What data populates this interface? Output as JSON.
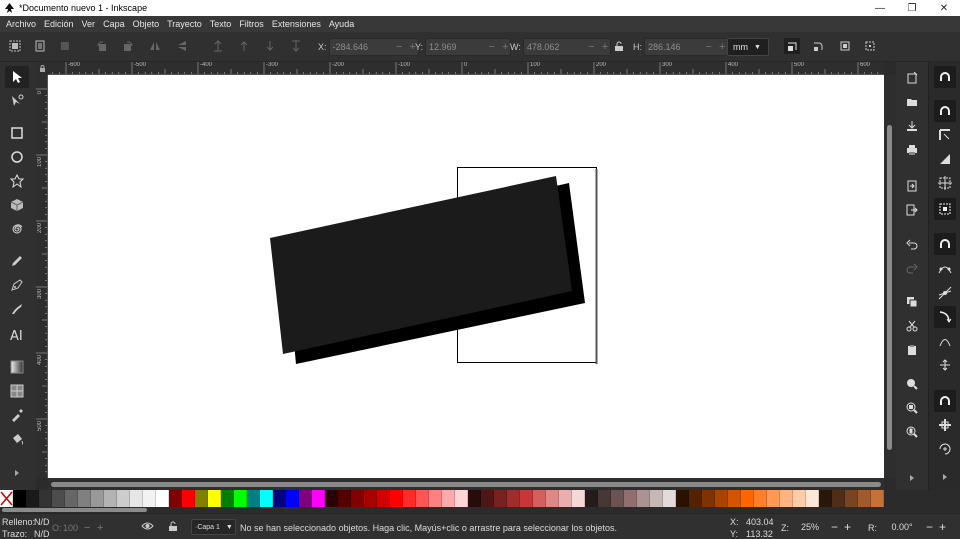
{
  "window": {
    "title": "*Documento nuevo 1 - Inkscape",
    "controls": [
      "—",
      "❐",
      "✕"
    ]
  },
  "menu": [
    "Archivo",
    "Edición",
    "Ver",
    "Capa",
    "Objeto",
    "Trayecto",
    "Texto",
    "Filtros",
    "Extensiones",
    "Ayuda"
  ],
  "toolcontrols": {
    "x_label": "X:",
    "x_value": "-284.646",
    "y_label": "Y:",
    "y_value": "12.969",
    "w_label": "W:",
    "w_value": "478.062",
    "h_label": "H:",
    "h_value": "286.146",
    "unit": "mm",
    "minus": "−",
    "plus": "+"
  },
  "rulers": {
    "horizontal": [
      "-600",
      "-500",
      "-400",
      "-300",
      "-200",
      "-100",
      "0",
      "100",
      "200",
      "300",
      "400",
      "500",
      "600"
    ],
    "vertical": [
      "0",
      "100",
      "200",
      "300",
      "400",
      "500",
      "600",
      "700"
    ]
  },
  "palette": {
    "colors": [
      "#000000",
      "#1a1a1a",
      "#333333",
      "#4d4d4d",
      "#666666",
      "#808080",
      "#999999",
      "#b3b3b3",
      "#cccccc",
      "#e6e6e6",
      "#f2f2f2",
      "#ffffff",
      "#800000",
      "#ff0000",
      "#808000",
      "#ffff00",
      "#008000",
      "#00ff00",
      "#008080",
      "#00ffff",
      "#000080",
      "#0000ff",
      "#800080",
      "#ff00ff",
      "#2b0000",
      "#550000",
      "#800000",
      "#aa0000",
      "#d40000",
      "#ff0000",
      "#ff2a2a",
      "#ff5555",
      "#ff8080",
      "#ffaaaa",
      "#ffd5d5",
      "#280b0b",
      "#501616",
      "#782121",
      "#a02c2c",
      "#c83737",
      "#d35f5f",
      "#de8787",
      "#e9afaf",
      "#f4d7d7",
      "#241c1c",
      "#483737",
      "#6c5353",
      "#916f6f",
      "#ac9393",
      "#c8b7b7",
      "#e3dbdb",
      "#2b1100",
      "#552200",
      "#803300",
      "#aa4400",
      "#d45500",
      "#ff6600",
      "#ff7f2a",
      "#ff9955",
      "#ffb380",
      "#ffccaa",
      "#ffe6d5",
      "#28170b",
      "#502d16",
      "#784421",
      "#a05a2c",
      "#c87137"
    ]
  },
  "status": {
    "fill_label": "Relleno:",
    "fill_value": "N/D",
    "stroke_label": "Trazo:",
    "stroke_value": "N/D",
    "opacity_label": "O:",
    "opacity_value": "100",
    "layer": "·Capa 1",
    "message": "No se han seleccionado objetos. Haga clic, Mayús+clic o arrastre para seleccionar los objetos.",
    "x_label": "X:",
    "x_value": "403.04",
    "y_label": "Y:",
    "y_value": "113.32",
    "zoom_label": "Z:",
    "zoom_value": "25%",
    "rotation_label": "R:",
    "rotation_value": "0.00°"
  },
  "icons": {
    "tools": [
      "selector-icon",
      "node-icon",
      "rectangle-icon",
      "ellipse-icon",
      "star-icon",
      "box3d-icon",
      "spiral-icon",
      "pencil-icon",
      "pen-icon",
      "calligraphy-icon",
      "text-icon",
      "gradient-icon",
      "mesh-icon",
      "dropper-icon",
      "paintbucket-icon"
    ],
    "commands": [
      "new-icon",
      "open-icon",
      "save-icon",
      "print-icon",
      "import-icon",
      "export-icon",
      "undo-icon",
      "redo-icon",
      "copy-icon",
      "cut-icon",
      "paste-icon",
      "zoom-selection-icon",
      "zoom-drawing-icon",
      "zoom-page-icon"
    ]
  }
}
